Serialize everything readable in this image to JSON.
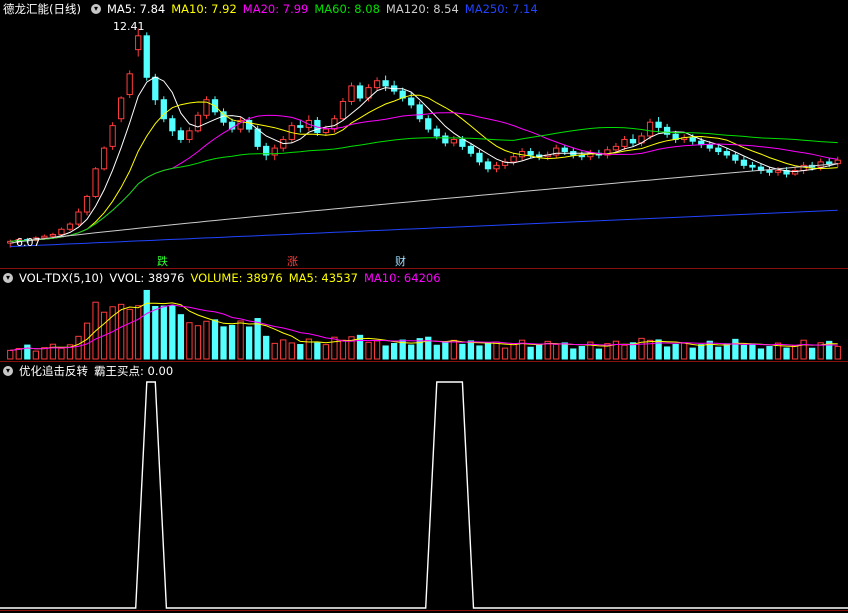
{
  "main": {
    "title": "德龙汇能(日线)",
    "ma": [
      {
        "label": "MA5: 7.84",
        "color": "#ffffff"
      },
      {
        "label": "MA10: 7.92",
        "color": "#ffff00"
      },
      {
        "label": "MA20: 7.99",
        "color": "#ff00ff"
      },
      {
        "label": "MA60: 8.08",
        "color": "#00e000"
      },
      {
        "label": "MA120: 8.54",
        "color": "#cccccc"
      },
      {
        "label": "MA250: 7.14",
        "color": "#2244ff"
      }
    ],
    "high_label": "12.41",
    "low_label": "6.07",
    "marks": [
      {
        "text": "跌",
        "color": "#33ff33"
      },
      {
        "text": "涨",
        "color": "#ff4040"
      },
      {
        "text": "财",
        "color": "#9fdfff"
      }
    ]
  },
  "volume": {
    "title": "VOL-TDX(5,10)",
    "items": [
      {
        "label": "VVOL: 38976",
        "color": "#ffffff"
      },
      {
        "label": "VOLUME: 38976",
        "color": "#ffff00"
      },
      {
        "label": "MA5: 43537",
        "color": "#ffff00"
      },
      {
        "label": "MA10: 64206",
        "color": "#ff00ff"
      }
    ]
  },
  "indicator": {
    "title": "优化追击反转",
    "items": [
      {
        "label": "霸王买点: 0.00",
        "color": "#ffffff"
      }
    ]
  },
  "chart_data": {
    "type": "candlestick",
    "price_ylim": [
      6.0,
      12.6
    ],
    "candles": [
      [
        6.2,
        6.25,
        6.07,
        6.3
      ],
      [
        6.25,
        6.3,
        6.2,
        6.35
      ],
      [
        6.3,
        6.28,
        6.2,
        6.35
      ],
      [
        6.28,
        6.35,
        6.25,
        6.4
      ],
      [
        6.35,
        6.4,
        6.3,
        6.45
      ],
      [
        6.4,
        6.45,
        6.35,
        6.5
      ],
      [
        6.45,
        6.6,
        6.4,
        6.65
      ],
      [
        6.6,
        6.75,
        6.55,
        6.8
      ],
      [
        6.75,
        7.1,
        6.7,
        7.2
      ],
      [
        7.1,
        7.55,
        7.0,
        7.6
      ],
      [
        7.55,
        8.35,
        7.5,
        8.4
      ],
      [
        8.35,
        8.95,
        8.3,
        9.0
      ],
      [
        9.0,
        9.6,
        8.9,
        9.7
      ],
      [
        9.8,
        10.4,
        9.7,
        10.45
      ],
      [
        10.5,
        11.1,
        10.4,
        11.2
      ],
      [
        11.8,
        12.2,
        11.6,
        12.41
      ],
      [
        12.2,
        11.0,
        10.9,
        12.3
      ],
      [
        11.0,
        10.35,
        10.2,
        11.1
      ],
      [
        10.35,
        9.8,
        9.7,
        10.45
      ],
      [
        9.8,
        9.45,
        9.3,
        9.9
      ],
      [
        9.45,
        9.2,
        9.1,
        9.55
      ],
      [
        9.2,
        9.45,
        9.1,
        9.55
      ],
      [
        9.45,
        9.9,
        9.4,
        10.0
      ],
      [
        9.9,
        10.35,
        9.8,
        10.45
      ],
      [
        10.35,
        10.0,
        9.9,
        10.45
      ],
      [
        10.0,
        9.7,
        9.6,
        10.1
      ],
      [
        9.7,
        9.5,
        9.4,
        9.8
      ],
      [
        9.5,
        9.75,
        9.4,
        9.85
      ],
      [
        9.75,
        9.5,
        9.4,
        9.85
      ],
      [
        9.5,
        9.0,
        8.9,
        9.6
      ],
      [
        9.0,
        8.75,
        8.6,
        9.1
      ],
      [
        8.75,
        8.95,
        8.6,
        9.05
      ],
      [
        8.95,
        9.2,
        8.85,
        9.3
      ],
      [
        9.2,
        9.6,
        9.1,
        9.7
      ],
      [
        9.6,
        9.55,
        9.4,
        9.75
      ],
      [
        9.55,
        9.75,
        9.45,
        9.9
      ],
      [
        9.75,
        9.4,
        9.3,
        9.85
      ],
      [
        9.4,
        9.5,
        9.3,
        9.6
      ],
      [
        9.5,
        9.8,
        9.4,
        9.9
      ],
      [
        9.8,
        10.3,
        9.75,
        10.4
      ],
      [
        10.3,
        10.75,
        10.2,
        10.85
      ],
      [
        10.75,
        10.4,
        10.3,
        10.85
      ],
      [
        10.4,
        10.7,
        10.3,
        10.8
      ],
      [
        10.7,
        10.9,
        10.6,
        11.0
      ],
      [
        10.9,
        10.75,
        10.6,
        11.05
      ],
      [
        10.75,
        10.6,
        10.5,
        10.9
      ],
      [
        10.6,
        10.4,
        10.3,
        10.7
      ],
      [
        10.4,
        10.2,
        10.1,
        10.55
      ],
      [
        10.2,
        9.8,
        9.7,
        10.3
      ],
      [
        9.8,
        9.5,
        9.4,
        9.9
      ],
      [
        9.5,
        9.3,
        9.2,
        9.6
      ],
      [
        9.3,
        9.1,
        9.0,
        9.4
      ],
      [
        9.1,
        9.2,
        9.0,
        9.3
      ],
      [
        9.2,
        9.0,
        8.9,
        9.3
      ],
      [
        9.0,
        8.8,
        8.7,
        9.1
      ],
      [
        8.8,
        8.55,
        8.45,
        8.9
      ],
      [
        8.55,
        8.35,
        8.25,
        8.65
      ],
      [
        8.35,
        8.45,
        8.25,
        8.55
      ],
      [
        8.45,
        8.55,
        8.35,
        8.65
      ],
      [
        8.55,
        8.7,
        8.45,
        8.8
      ],
      [
        8.7,
        8.85,
        8.6,
        8.95
      ],
      [
        8.85,
        8.75,
        8.65,
        8.95
      ],
      [
        8.75,
        8.7,
        8.6,
        8.85
      ],
      [
        8.7,
        8.75,
        8.6,
        8.85
      ],
      [
        8.75,
        8.95,
        8.65,
        9.05
      ],
      [
        8.95,
        8.85,
        8.75,
        9.05
      ],
      [
        8.85,
        8.75,
        8.65,
        8.95
      ],
      [
        8.75,
        8.7,
        8.6,
        8.85
      ],
      [
        8.7,
        8.8,
        8.6,
        8.9
      ],
      [
        8.8,
        8.75,
        8.65,
        8.9
      ],
      [
        8.75,
        8.9,
        8.65,
        9.0
      ],
      [
        8.9,
        9.0,
        8.8,
        9.1
      ],
      [
        9.0,
        9.2,
        8.9,
        9.3
      ],
      [
        9.2,
        9.1,
        9.0,
        9.35
      ],
      [
        9.1,
        9.3,
        9.0,
        9.4
      ],
      [
        9.3,
        9.7,
        9.2,
        9.8
      ],
      [
        9.7,
        9.55,
        9.4,
        9.85
      ],
      [
        9.55,
        9.35,
        9.25,
        9.65
      ],
      [
        9.35,
        9.2,
        9.1,
        9.45
      ],
      [
        9.2,
        9.25,
        9.1,
        9.35
      ],
      [
        9.25,
        9.15,
        9.05,
        9.35
      ],
      [
        9.15,
        9.05,
        8.95,
        9.25
      ],
      [
        9.05,
        8.95,
        8.85,
        9.15
      ],
      [
        8.95,
        8.85,
        8.75,
        9.05
      ],
      [
        8.85,
        8.75,
        8.65,
        8.95
      ],
      [
        8.75,
        8.6,
        8.5,
        8.85
      ],
      [
        8.6,
        8.45,
        8.35,
        8.7
      ],
      [
        8.45,
        8.4,
        8.3,
        8.55
      ],
      [
        8.4,
        8.3,
        8.2,
        8.5
      ],
      [
        8.3,
        8.25,
        8.15,
        8.4
      ],
      [
        8.25,
        8.3,
        8.15,
        8.4
      ],
      [
        8.3,
        8.2,
        8.1,
        8.4
      ],
      [
        8.2,
        8.3,
        8.15,
        8.4
      ],
      [
        8.3,
        8.45,
        8.2,
        8.55
      ],
      [
        8.45,
        8.4,
        8.3,
        8.55
      ],
      [
        8.4,
        8.55,
        8.3,
        8.65
      ],
      [
        8.55,
        8.5,
        8.4,
        8.65
      ],
      [
        8.5,
        8.6,
        8.4,
        8.7
      ]
    ],
    "indicator_spikes": [
      {
        "start": 16,
        "end": 17,
        "value": 1
      },
      {
        "start": 50,
        "end": 53,
        "value": 1
      }
    ]
  }
}
